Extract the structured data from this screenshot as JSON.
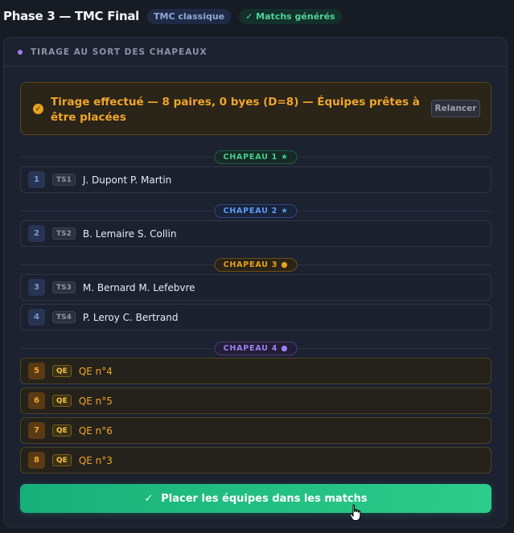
{
  "header": {
    "title": "Phase 3 — TMC Final",
    "badge_format": "TMC classique",
    "badge_status": "✓ Matchs générés"
  },
  "panel": {
    "title": "TIRAGE AU SORT DES CHAPEAUX"
  },
  "alert": {
    "icon": "check-circle-icon",
    "text": "Tirage effectué — 8 paires, 0 byes (D=8) — Équipes prêtes à être placées",
    "button_label": "Relancer"
  },
  "hats": [
    {
      "label": "CHAPEAU 1 ★",
      "teams": [
        {
          "num": "1",
          "tag": "TS1",
          "name": "J. Dupont P. Martin"
        }
      ]
    },
    {
      "label": "CHAPEAU 2 ★",
      "teams": [
        {
          "num": "2",
          "tag": "TS2",
          "name": "B. Lemaire S. Collin"
        }
      ]
    },
    {
      "label": "CHAPEAU 3 ●",
      "teams": [
        {
          "num": "3",
          "tag": "TS3",
          "name": "M. Bernard M. Lefebvre"
        },
        {
          "num": "4",
          "tag": "TS4",
          "name": "P. Leroy C. Bertrand"
        }
      ]
    },
    {
      "label": "CHAPEAU 4 ●",
      "teams": [
        {
          "num": "5",
          "tag": "QE",
          "name": "QE n°4"
        },
        {
          "num": "6",
          "tag": "QE",
          "name": "QE n°5"
        },
        {
          "num": "7",
          "tag": "QE",
          "name": "QE n°6"
        },
        {
          "num": "8",
          "tag": "QE",
          "name": "QE n°3"
        }
      ]
    }
  ],
  "cta": {
    "icon": "check-icon",
    "label": "Placer les équipes dans les matchs"
  },
  "colors": {
    "accent_green": "#2ccc8a",
    "warning_orange": "#f0a52a",
    "hat1": "#3fcf8e",
    "hat2": "#5a9bf5",
    "hat3": "#e8a11c",
    "hat4": "#9f7ef0"
  }
}
